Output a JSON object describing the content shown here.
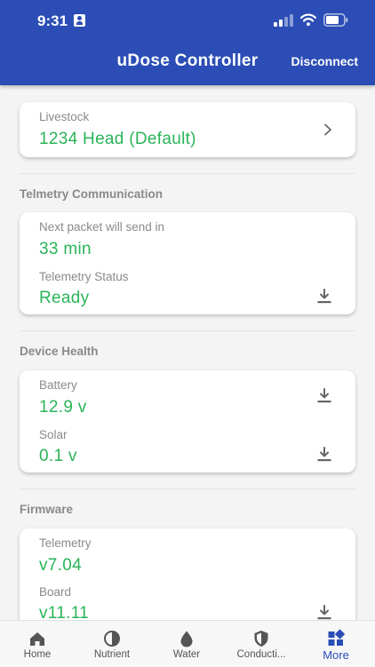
{
  "status_bar": {
    "time": "9:31"
  },
  "header": {
    "title": "uDose Controller",
    "action_label": "Disconnect"
  },
  "livestock": {
    "label": "Livestock",
    "value": "1234 Head (Default)"
  },
  "telemetry_communication": {
    "section_title": "Telmetry Communication",
    "next_packet_label": "Next packet will send in",
    "next_packet_value": "33 min",
    "status_label": "Telemetry Status",
    "status_value": "Ready"
  },
  "device_health": {
    "section_title": "Device Health",
    "battery_label": "Battery",
    "battery_value": "12.9 v",
    "solar_label": "Solar",
    "solar_value": "0.1 v"
  },
  "firmware": {
    "section_title": "Firmware",
    "telemetry_label": "Telemetry",
    "telemetry_value": "v7.04",
    "board_label": "Board",
    "board_value": "v11.11"
  },
  "tabs": [
    {
      "label": "Home",
      "icon": "home-icon"
    },
    {
      "label": "Nutrient",
      "icon": "nutrient-icon"
    },
    {
      "label": "Water",
      "icon": "water-drop-icon"
    },
    {
      "label": "Conducti...",
      "icon": "shield-icon"
    },
    {
      "label": "More",
      "icon": "grid-icon"
    }
  ],
  "colors": {
    "header": "#2b4db5",
    "value_green": "#2ab459",
    "label_grey": "#8a8a8e",
    "active_tab": "#2b4db5"
  }
}
